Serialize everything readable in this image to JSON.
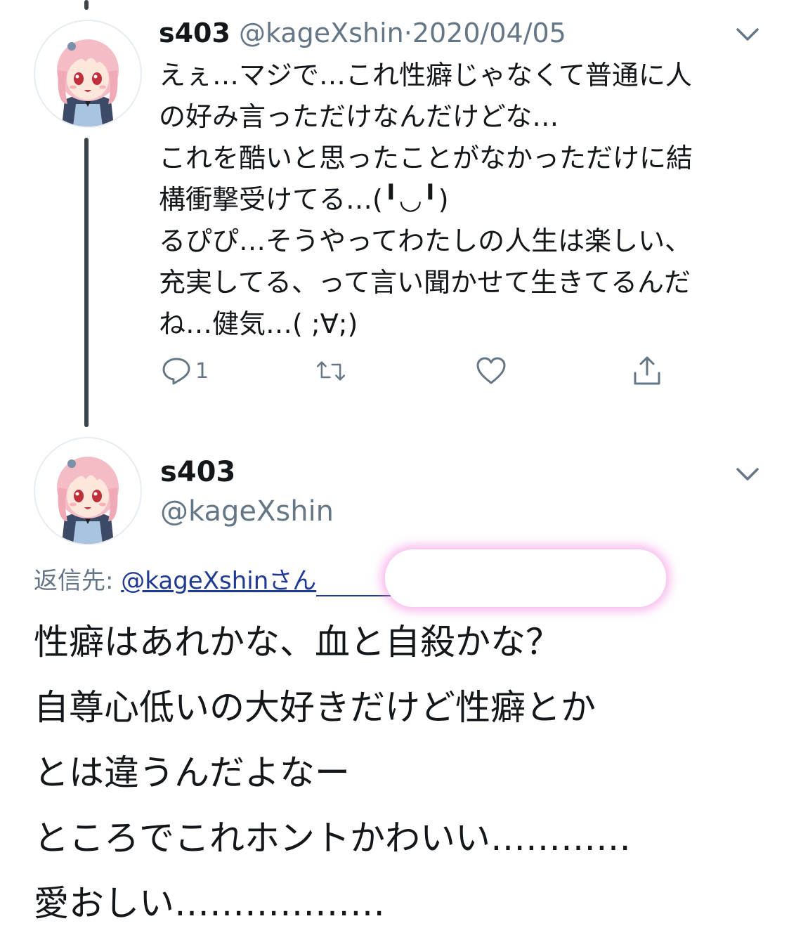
{
  "tweet1": {
    "display_name": "s403",
    "handle": "@kageXshin",
    "separator": "·",
    "date": "2020/04/05",
    "avatar_icon": "anime-girl-avatar",
    "menu_icon": "chevron-down-icon",
    "text_lines": [
      "えぇ…マジで…これ性癖じゃなくて普通に人",
      "の好み言っただけなんだけどな…",
      "これを酷いと思ったことがなかっただけに結",
      "構衝撃受けてる…(╹◡╹)",
      "るぴぴ…そうやってわたしの人生は楽しい、",
      "充実してる、って言い聞かせて生きてるんだ",
      "ね…健気…( ;∀;)"
    ],
    "actions": {
      "reply_count": "1",
      "reply_icon": "reply-icon",
      "retweet_icon": "retweet-icon",
      "like_icon": "heart-icon",
      "share_icon": "share-icon"
    }
  },
  "tweet2": {
    "display_name": "s403",
    "handle": "@kageXshin",
    "avatar_icon": "anime-girl-avatar",
    "menu_icon": "chevron-down-icon",
    "reply_to_label": "返信先: ",
    "reply_to_link": "@kageXshinさん",
    "text_lines": [
      "性癖はあれかな、血と自殺かな？",
      "自尊心低いの大好きだけど性癖とか",
      "とは違うんだよなー",
      "ところでこれホントかわいい…………",
      "愛おしい………………"
    ]
  },
  "colors": {
    "text_primary": "#14171a",
    "text_secondary": "#657786",
    "link": "#1f3a93",
    "thread_line": "#3b4248",
    "redaction_glow": "#f082dc"
  }
}
